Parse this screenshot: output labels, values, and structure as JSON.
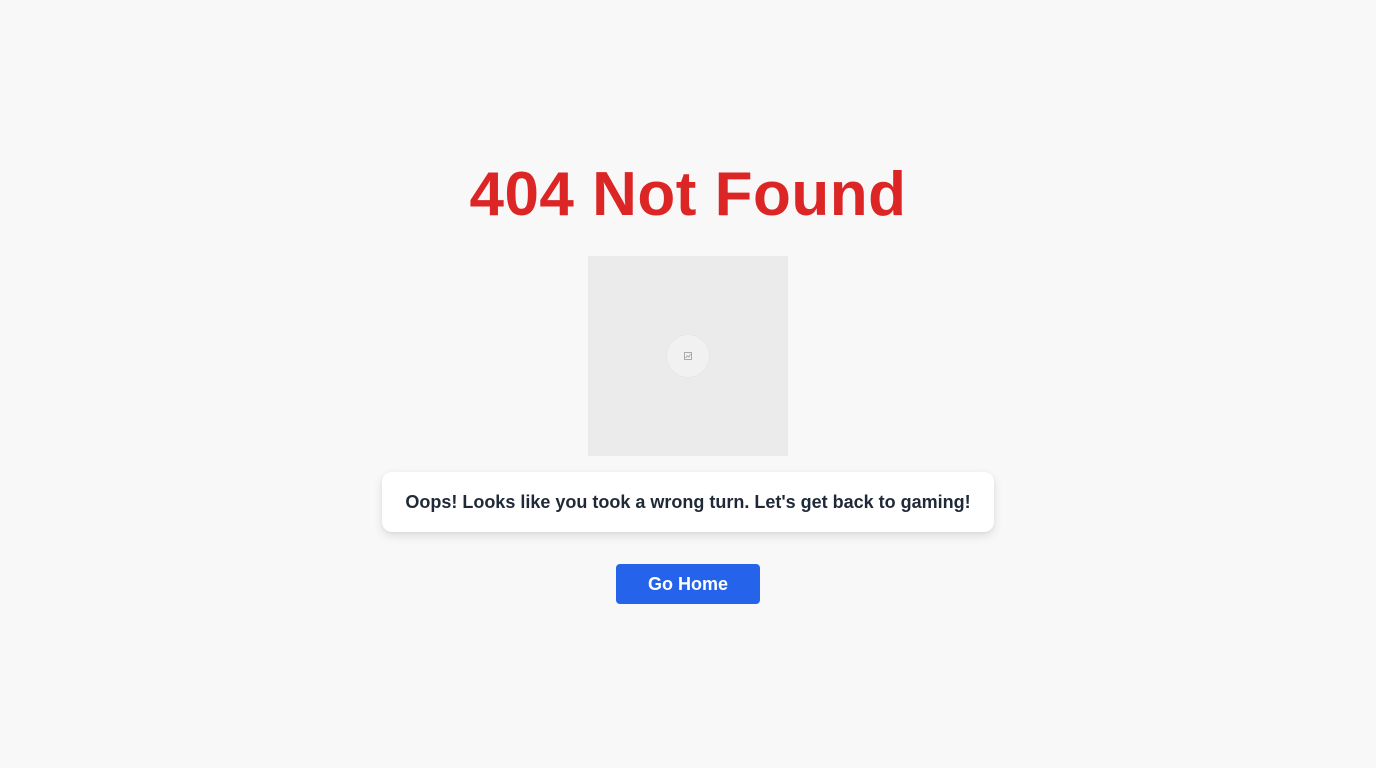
{
  "error": {
    "title": "404 Not Found",
    "message": "Oops! Looks like you took a wrong turn. Let's get back to gaming!"
  },
  "image": {
    "state": "loading",
    "icon": "broken-image-icon"
  },
  "actions": {
    "home_label": "Go Home"
  },
  "colors": {
    "background": "#f8f8f8",
    "title": "#dc2626",
    "button": "#2563eb",
    "placeholder": "#ebebeb"
  }
}
